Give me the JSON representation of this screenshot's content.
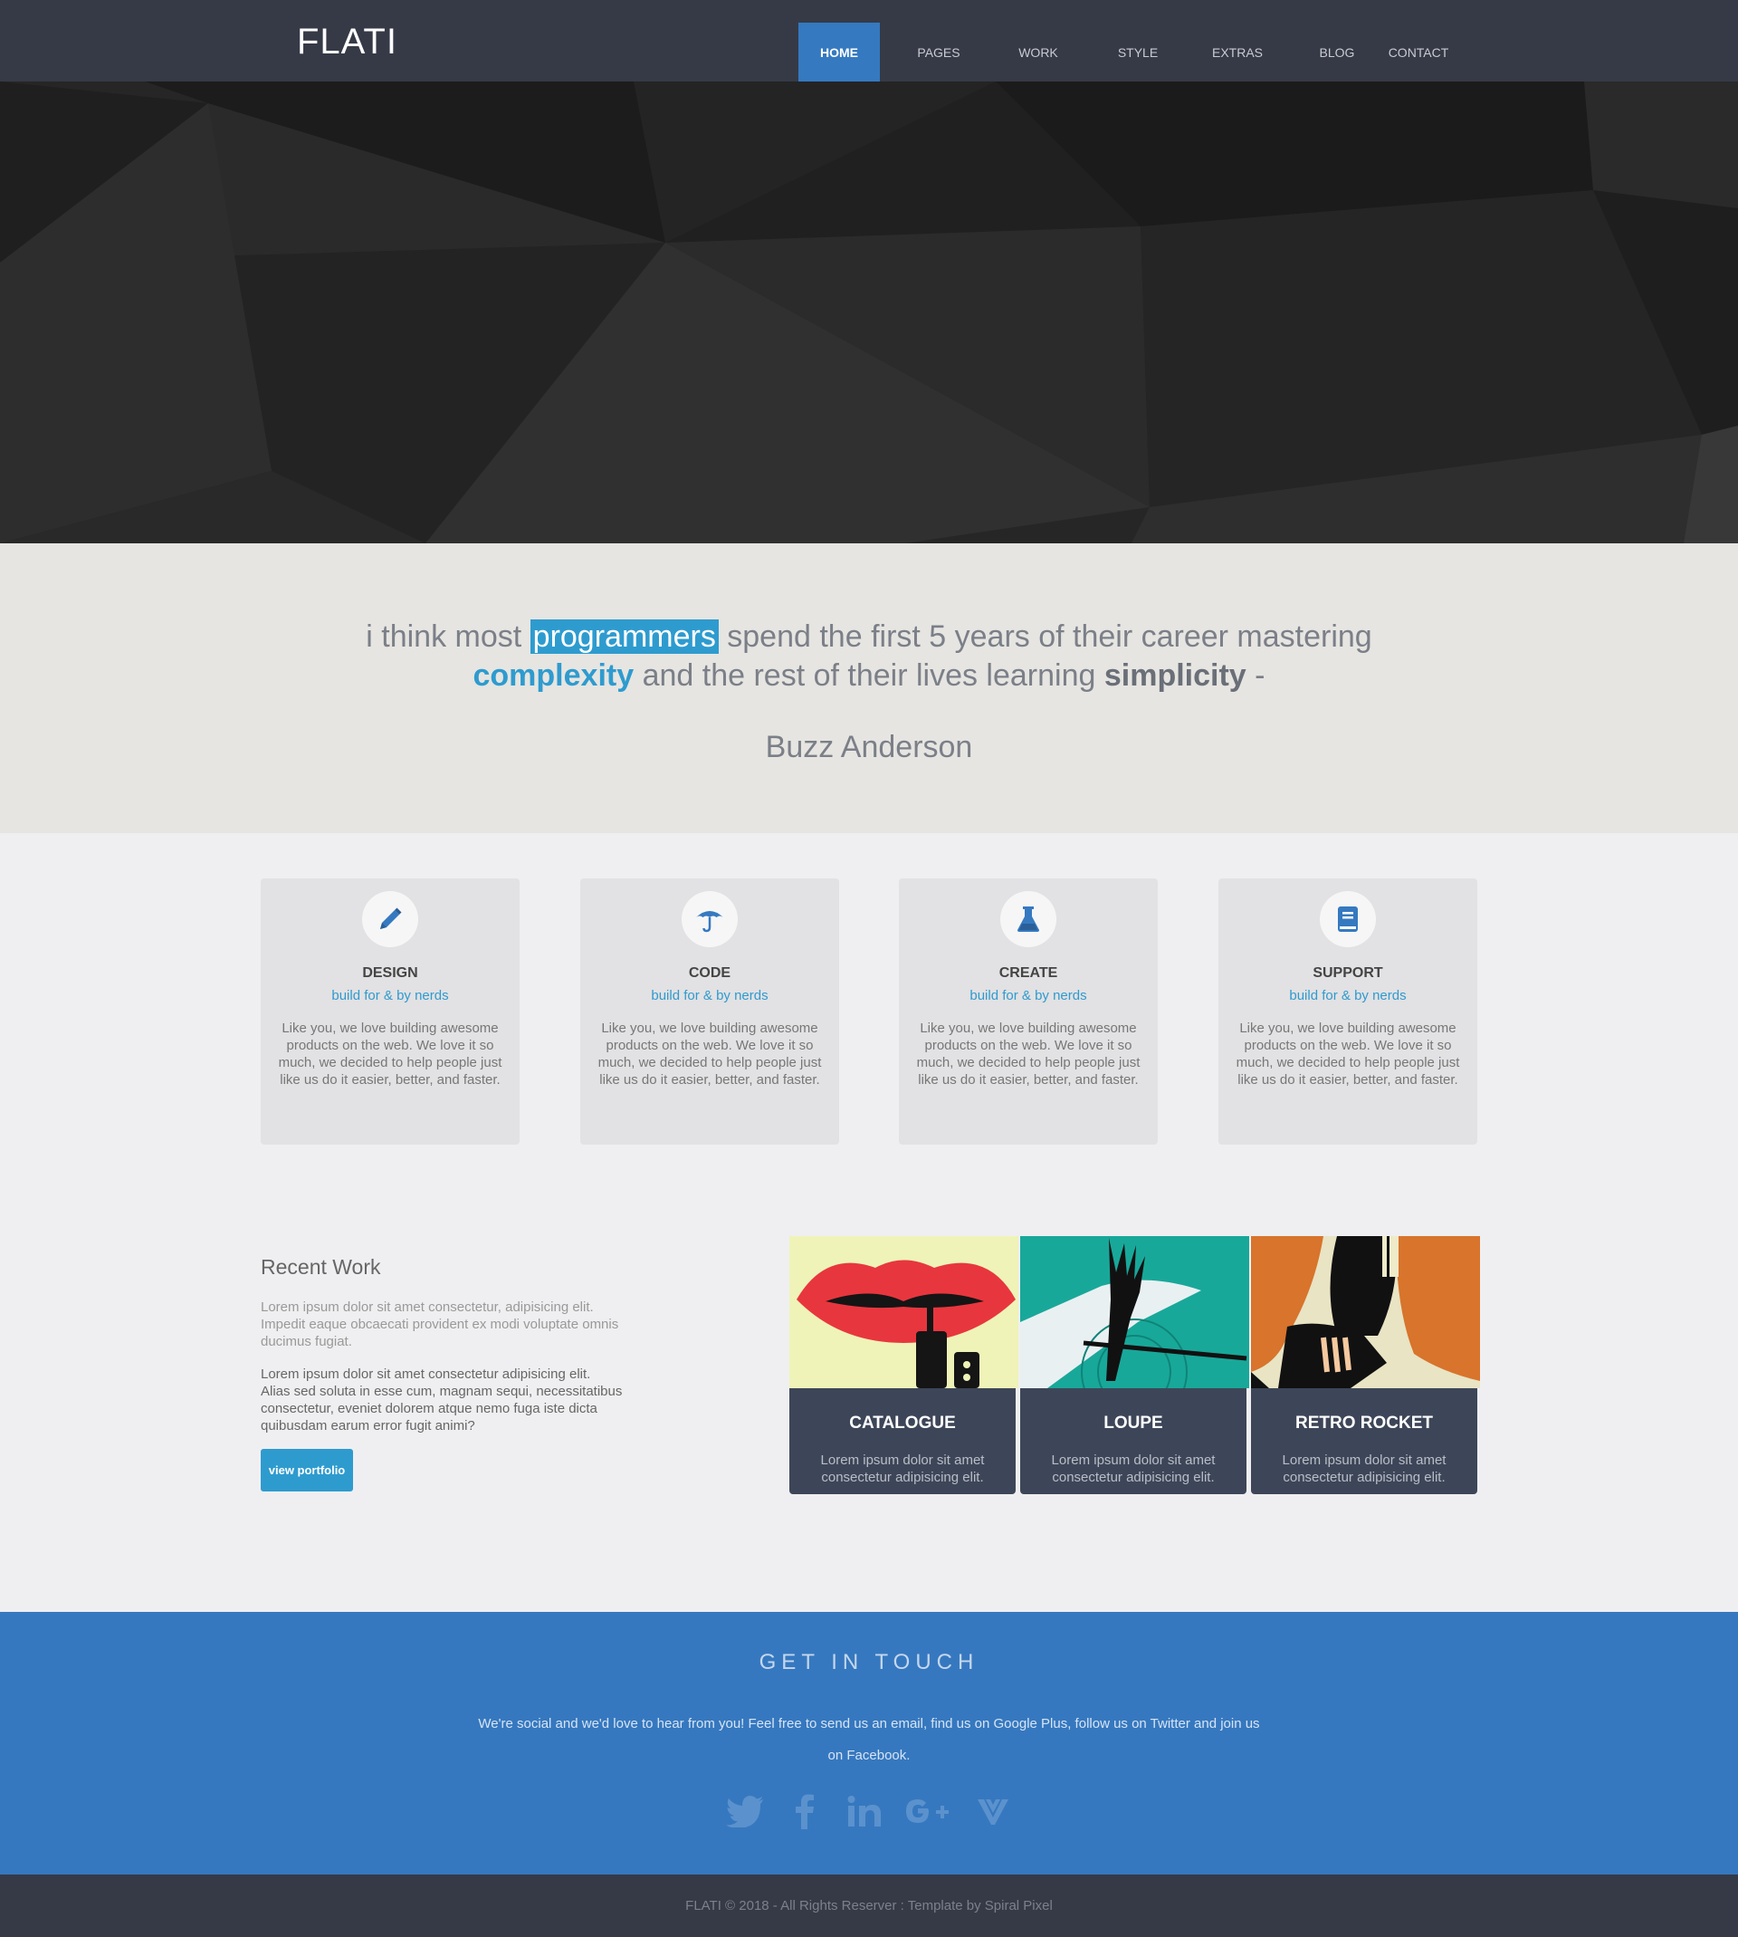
{
  "header": {
    "brand": "FLATI",
    "nav": [
      {
        "label": "HOME",
        "active": true
      },
      {
        "label": "PAGES"
      },
      {
        "label": "WORK"
      },
      {
        "label": "STYLE"
      },
      {
        "label": "EXTRAS"
      },
      {
        "label": "BLOG"
      },
      {
        "label": "CONTACT"
      }
    ]
  },
  "quote": {
    "part1": "i think most ",
    "highlight_box": "programmers",
    "part2": " spend the first 5 years of their career mastering",
    "highlight_blue": "complexity",
    "part3": " and the rest of their lives learning ",
    "highlight_bold": "simplicity",
    "part4": " -",
    "author": "Buzz Anderson"
  },
  "services": [
    {
      "icon": "pencil-icon",
      "title": "DESIGN",
      "subtitle": "build for & by nerds",
      "text": "Like you, we love building awesome products on the web. We love it so much, we decided to help people just like us do it easier, better, and faster."
    },
    {
      "icon": "umbrella-icon",
      "title": "CODE",
      "subtitle": "build for & by nerds",
      "text": "Like you, we love building awesome products on the web. We love it so much, we decided to help people just like us do it easier, better, and faster."
    },
    {
      "icon": "flask-icon",
      "title": "CREATE",
      "subtitle": "build for & by nerds",
      "text": "Like you, we love building awesome products on the web. We love it so much, we decided to help people just like us do it easier, better, and faster."
    },
    {
      "icon": "book-icon",
      "title": "SUPPORT",
      "subtitle": "build for & by nerds",
      "text": "Like you, we love building awesome products on the web. We love it so much, we decided to help people just like us do it easier, better, and faster."
    }
  ],
  "recent_work": {
    "title": "Recent Work",
    "paragraph1": "Lorem ipsum dolor sit amet consectetur, adipisicing elit. Impedit eaque obcaecati provident ex modi voluptate omnis ducimus fugiat.",
    "paragraph2": "Lorem ipsum dolor sit amet consectetur adipisicing elit. Alias sed soluta in esse cum, magnam sequi, necessitatibus consectetur, eveniet dolorem atque nemo fuga iste dicta quibusdam earum error fugit animi?",
    "button": "view portfolio",
    "cards": [
      {
        "title": "CATALOGUE",
        "text": "Lorem ipsum dolor sit amet consectetur adipisicing elit."
      },
      {
        "title": "LOUPE",
        "text": "Lorem ipsum dolor sit amet consectetur adipisicing elit."
      },
      {
        "title": "RETRO ROCKET",
        "text": "Lorem ipsum dolor sit amet consectetur adipisicing elit."
      }
    ]
  },
  "contact": {
    "title": "GET IN TOUCH",
    "text": "We're social and we'd love to hear from you! Feel free to send us an email, find us on Google Plus, follow us on Twitter and join us on Facebook.",
    "socials": [
      "twitter-icon",
      "facebook-icon",
      "linkedin-icon",
      "google-plus-icon",
      "vimeo-icon"
    ]
  },
  "footer": {
    "text": "FLATI © 2018 - All Rights Reserver : Template by Spiral Pixel"
  },
  "colors": {
    "nav_bg": "#363a47",
    "accent_blue": "#3579c0",
    "highlight_blue": "#2e9bcf",
    "quote_bg": "#e6e5e1",
    "card_dark": "#3d4658"
  }
}
